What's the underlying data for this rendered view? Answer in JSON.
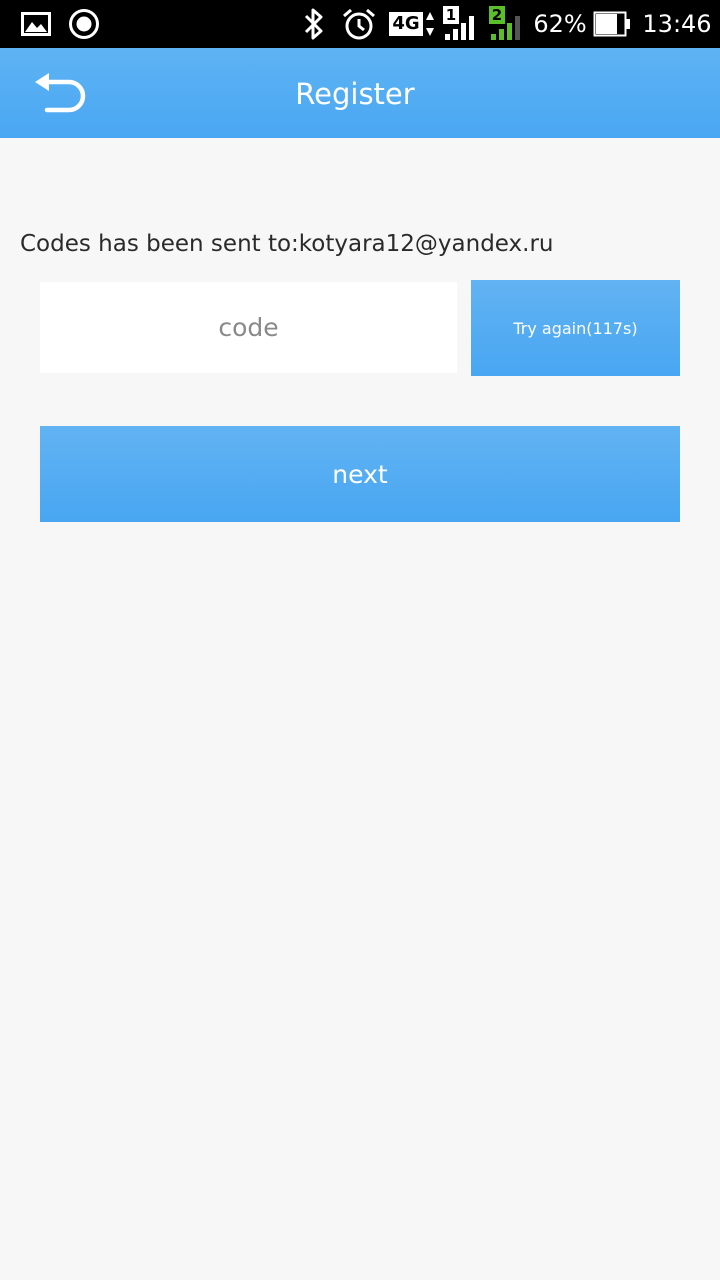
{
  "status_bar": {
    "icons": [
      "image-icon",
      "record-icon",
      "bluetooth-icon",
      "alarm-icon",
      "4g-icon",
      "signal-sim1-icon",
      "signal-sim2-icon",
      "battery-icon"
    ],
    "network": "4G",
    "sim1": "1",
    "sim2": "2",
    "battery": "62%",
    "time": "13:46",
    "colors": {
      "sim2": "#5bbf2b"
    }
  },
  "app_bar": {
    "title": "Register",
    "back_icon": "back-arrow-icon",
    "color": "#4aa7f3"
  },
  "form": {
    "sent_message": "Codes has been sent to:kotyara12@yandex.ru",
    "code_placeholder": "code",
    "code_value": "",
    "retry_label": "Try again(117s)",
    "next_label": "next"
  }
}
